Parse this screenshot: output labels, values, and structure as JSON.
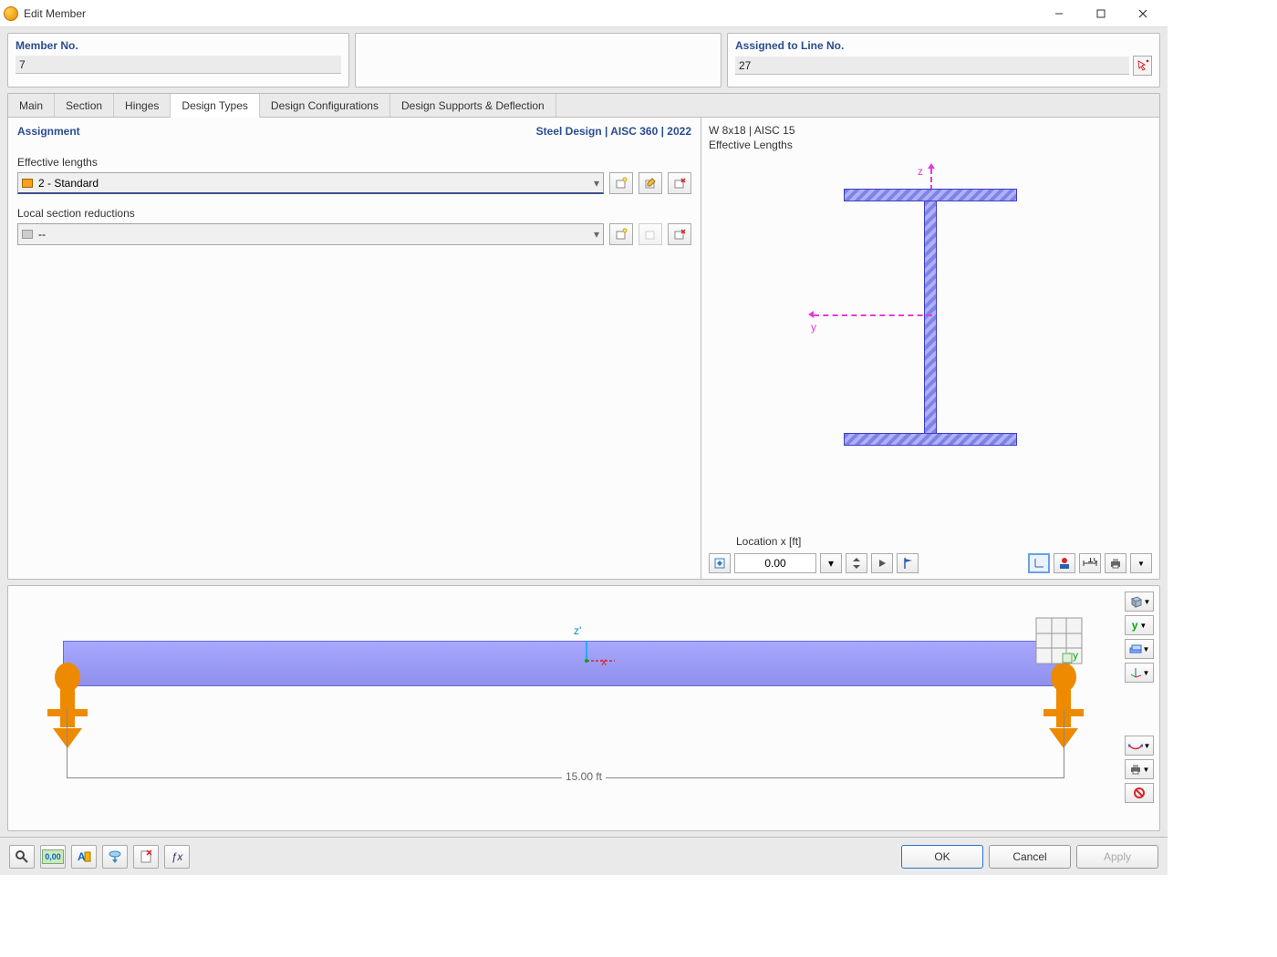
{
  "window": {
    "title": "Edit Member"
  },
  "header": {
    "member_label": "Member No.",
    "member_value": "7",
    "line_label": "Assigned to Line No.",
    "line_value": "27"
  },
  "tabs": [
    "Main",
    "Section",
    "Hinges",
    "Design Types",
    "Design Configurations",
    "Design Supports & Deflection"
  ],
  "active_tab": 3,
  "assignment": {
    "title": "Assignment",
    "design_code": "Steel Design | AISC 360 | 2022",
    "eff_len_label": "Effective lengths",
    "eff_len_value": "2 - Standard",
    "lsr_label": "Local section reductions",
    "lsr_value": "--"
  },
  "section_preview": {
    "name": "W 8x18 | AISC 15",
    "subtitle": "Effective Lengths",
    "z_label": "z",
    "y_label": "y",
    "location_label": "Location x [ft]",
    "location_value": "0.00"
  },
  "beam_preview": {
    "length_label": "15.00 ft",
    "z_label": "z'",
    "x_label": "x"
  },
  "buttons": {
    "ok": "OK",
    "cancel": "Cancel",
    "apply": "Apply"
  },
  "icons": {
    "new": "new-icon",
    "edit": "edit-icon",
    "del": "delete-icon",
    "pick": "pick-icon"
  }
}
